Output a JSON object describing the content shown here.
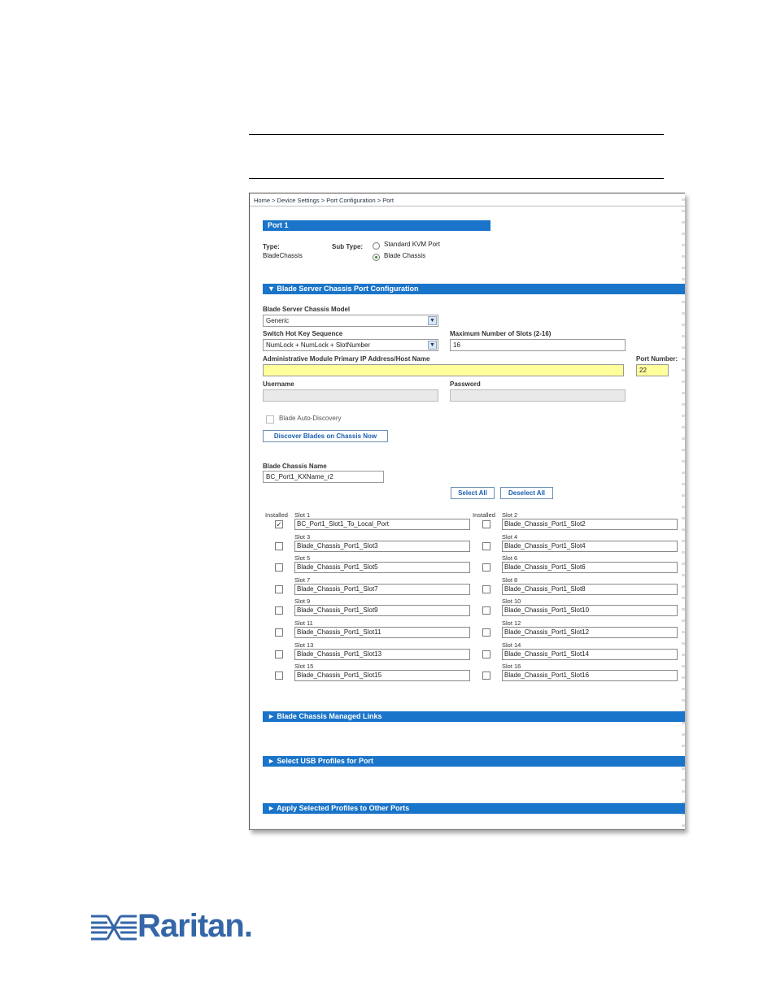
{
  "breadcrumb": "Home > Device Settings > Port Configuration > Port",
  "port_title": "Port 1",
  "type_label": "Type:",
  "type_value": "BladeChassis",
  "subtype_label": "Sub Type:",
  "subtype_options": [
    "Standard KVM Port",
    "Blade Chassis"
  ],
  "subtype_selected": "Blade Chassis",
  "section_config": "▼ Blade Server Chassis Port Configuration",
  "model_label": "Blade Server Chassis Model",
  "model_value": "Generic",
  "hotkey_label": "Switch Hot Key Sequence",
  "hotkey_value": "NumLock + NumLock + SlotNumber",
  "maxslots_label": "Maximum Number of Slots (2-16)",
  "maxslots_value": "16",
  "admin_ip_label": "Administrative Module Primary IP Address/Host Name",
  "admin_ip_value": "",
  "port_number_label": "Port Number:",
  "port_number_value": "22",
  "username_label": "Username",
  "password_label": "Password",
  "autodiscovery_label": "Blade Auto-Discovery",
  "discover_button": "Discover Blades on Chassis Now",
  "chassis_name_label": "Blade Chassis Name",
  "chassis_name_value": "BC_Port1_KXName_r2",
  "select_all": "Select All",
  "deselect_all": "Deselect All",
  "installed_header": "Installed",
  "slots": [
    {
      "label": "Slot 1",
      "name": "BC_Port1_Slot1_To_Local_Port",
      "installed": true
    },
    {
      "label": "Slot 2",
      "name": "Blade_Chassis_Port1_Slot2",
      "installed": false
    },
    {
      "label": "Slot 3",
      "name": "Blade_Chassis_Port1_Slot3",
      "installed": false
    },
    {
      "label": "Slot 4",
      "name": "Blade_Chassis_Port1_Slot4",
      "installed": false
    },
    {
      "label": "Slot 5",
      "name": "Blade_Chassis_Port1_Slot5",
      "installed": false
    },
    {
      "label": "Slot 6",
      "name": "Blade_Chassis_Port1_Slot6",
      "installed": false
    },
    {
      "label": "Slot 7",
      "name": "Blade_Chassis_Port1_Slot7",
      "installed": false
    },
    {
      "label": "Slot 8",
      "name": "Blade_Chassis_Port1_Slot8",
      "installed": false
    },
    {
      "label": "Slot 9",
      "name": "Blade_Chassis_Port1_Slot9",
      "installed": false
    },
    {
      "label": "Slot 10",
      "name": "Blade_Chassis_Port1_Slot10",
      "installed": false
    },
    {
      "label": "Slot 11",
      "name": "Blade_Chassis_Port1_Slot11",
      "installed": false
    },
    {
      "label": "Slot 12",
      "name": "Blade_Chassis_Port1_Slot12",
      "installed": false
    },
    {
      "label": "Slot 13",
      "name": "Blade_Chassis_Port1_Slot13",
      "installed": false
    },
    {
      "label": "Slot 14",
      "name": "Blade_Chassis_Port1_Slot14",
      "installed": false
    },
    {
      "label": "Slot 15",
      "name": "Blade_Chassis_Port1_Slot15",
      "installed": false
    },
    {
      "label": "Slot 16",
      "name": "Blade_Chassis_Port1_Slot16",
      "installed": false
    }
  ],
  "section_links": "► Blade Chassis Managed Links",
  "section_usb": "► Select USB Profiles for Port",
  "section_apply": "► Apply Selected Profiles to Other Ports",
  "logo_text": "Raritan.",
  "colors": {
    "accent": "#1a74c9",
    "highlight": "#ffff9c",
    "brand": "#3466a8"
  }
}
